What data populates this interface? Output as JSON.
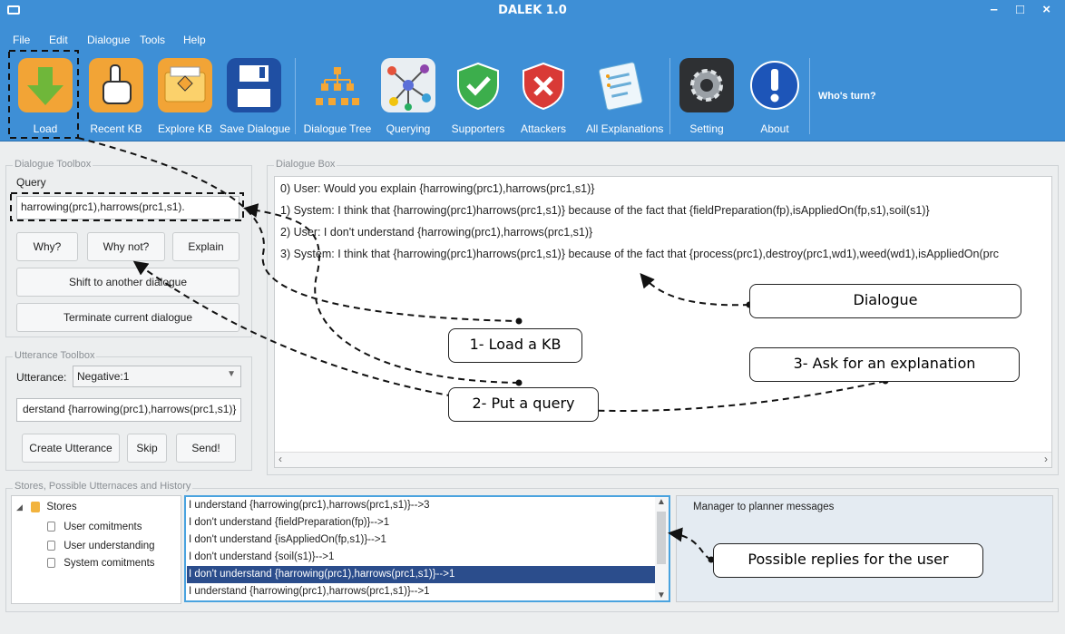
{
  "window": {
    "title": "DALEK 1.0",
    "controls": "– □ ×"
  },
  "menu": [
    "File",
    "Edit",
    "Dialogue",
    "Tools",
    "Help"
  ],
  "toolbar": {
    "load": "Load",
    "recent_kb": "Recent KB",
    "explore_kb": "Explore KB",
    "save_dialogue": "Save Dialogue",
    "dialogue_tree": "Dialogue Tree",
    "querying": "Querying",
    "supporters": "Supporters",
    "attackers": "Attackers",
    "all_explanations": "All Explanations",
    "setting": "Setting",
    "about": "About",
    "whos_turn": "Who's turn?"
  },
  "dialogue_toolbox": {
    "legend": "Dialogue Toolbox",
    "query_label": "Query",
    "query_value": "harrowing(prc1),harrows(prc1,s1).",
    "why": "Why?",
    "why_not": "Why not?",
    "explain": "Explain",
    "shift": "Shift to another dialogue",
    "terminate": "Terminate current dialogue"
  },
  "utterance_toolbox": {
    "legend": "Utterance Toolbox",
    "utterance_label": "Utterance:",
    "utterance_value": "Negative:1",
    "utterance_text": "derstand {harrowing(prc1),harrows(prc1,s1)}",
    "create": "Create Utterance",
    "skip": "Skip",
    "send": "Send!"
  },
  "dialogue_box": {
    "legend": "Dialogue Box",
    "lines": [
      "0) User: Would you explain {harrowing(prc1),harrows(prc1,s1)}",
      "1) System: I think that {harrowing(prc1)harrows(prc1,s1)} because of the fact that {fieldPreparation(fp),isAppliedOn(fp,s1),soil(s1)}",
      "2) User: I don't understand {harrowing(prc1),harrows(prc1,s1)}",
      "3) System: I think that {harrowing(prc1)harrows(prc1,s1)} because of the fact that {process(prc1),destroy(prc1,wd1),weed(wd1),isAppliedOn(prc"
    ]
  },
  "stores_panel": {
    "legend": "Stores, Possible Utternaces and History",
    "tree_root": "Stores",
    "tree_items": [
      "User comitments",
      "User understanding",
      "System comitments"
    ],
    "utterances": [
      "I understand {harrowing(prc1),harrows(prc1,s1)}-->3",
      "I don't understand {fieldPreparation(fp)}-->1",
      "I don't understand {isAppliedOn(fp,s1)}-->1",
      "I don't understand {soil(s1)}-->1",
      "I don't understand {harrowing(prc1),harrows(prc1,s1)}-->1",
      "I understand {harrowing(prc1),harrows(prc1,s1)}-->1"
    ],
    "selected_index": 4,
    "history_label": "Manager to planner messages"
  },
  "annotations": {
    "load_kb": "1- Load a KB",
    "put_query": "2- Put a query",
    "ask_explanation": "3- Ask for an explanation",
    "dialogue": "Dialogue",
    "possible_replies": "Possible replies for the user"
  },
  "colors": {
    "accent_blue": "#3e8fd6",
    "selected_row": "#2b4d8c",
    "focus_border": "#4aa3df"
  }
}
